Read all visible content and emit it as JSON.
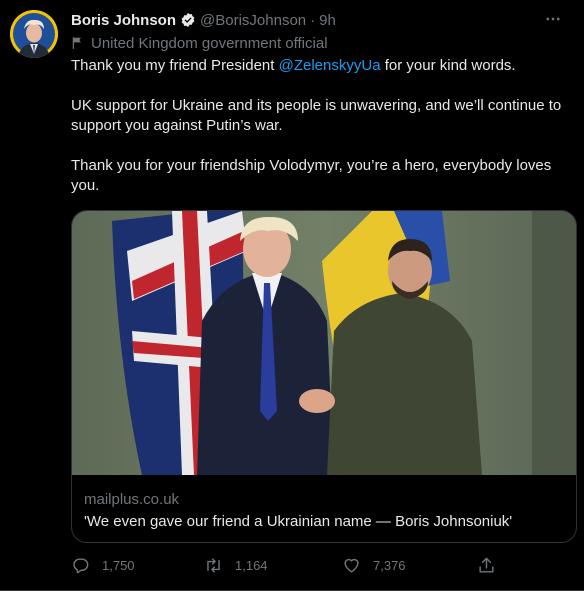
{
  "tweet": {
    "author_name": "Boris Johnson",
    "handle": "@BorisJohnson",
    "separator": "·",
    "time": "9h",
    "account_label": "United Kingdom government official",
    "text": {
      "p1_before": "Thank you my friend President ",
      "p1_mention": "@ZelenskyyUa",
      "p1_after": " for your kind words.",
      "p2": "UK support for Ukraine and its people is unwavering, and we’ll continue to support you against Putin’s war.",
      "p3": "Thank you for your friendship Volodymyr, you’re a hero, everybody loves you."
    },
    "card": {
      "domain": "mailplus.co.uk",
      "title": "'We even gave our friend a Ukrainian name — Boris Johnsoniuk'"
    },
    "stats": {
      "replies": "1,750",
      "retweets": "1,164",
      "likes": "7,376"
    }
  },
  "icons": {
    "verified": "verified-badge-icon",
    "label": "government-flag-icon",
    "more": "more-options-icon",
    "reply": "reply-icon",
    "retweet": "retweet-icon",
    "like": "heart-icon",
    "share": "share-icon"
  },
  "colors": {
    "background": "#000000",
    "text": "#e7e9ea",
    "secondary": "#71767b",
    "accent": "#1d9bf0",
    "border": "#2f3336"
  }
}
